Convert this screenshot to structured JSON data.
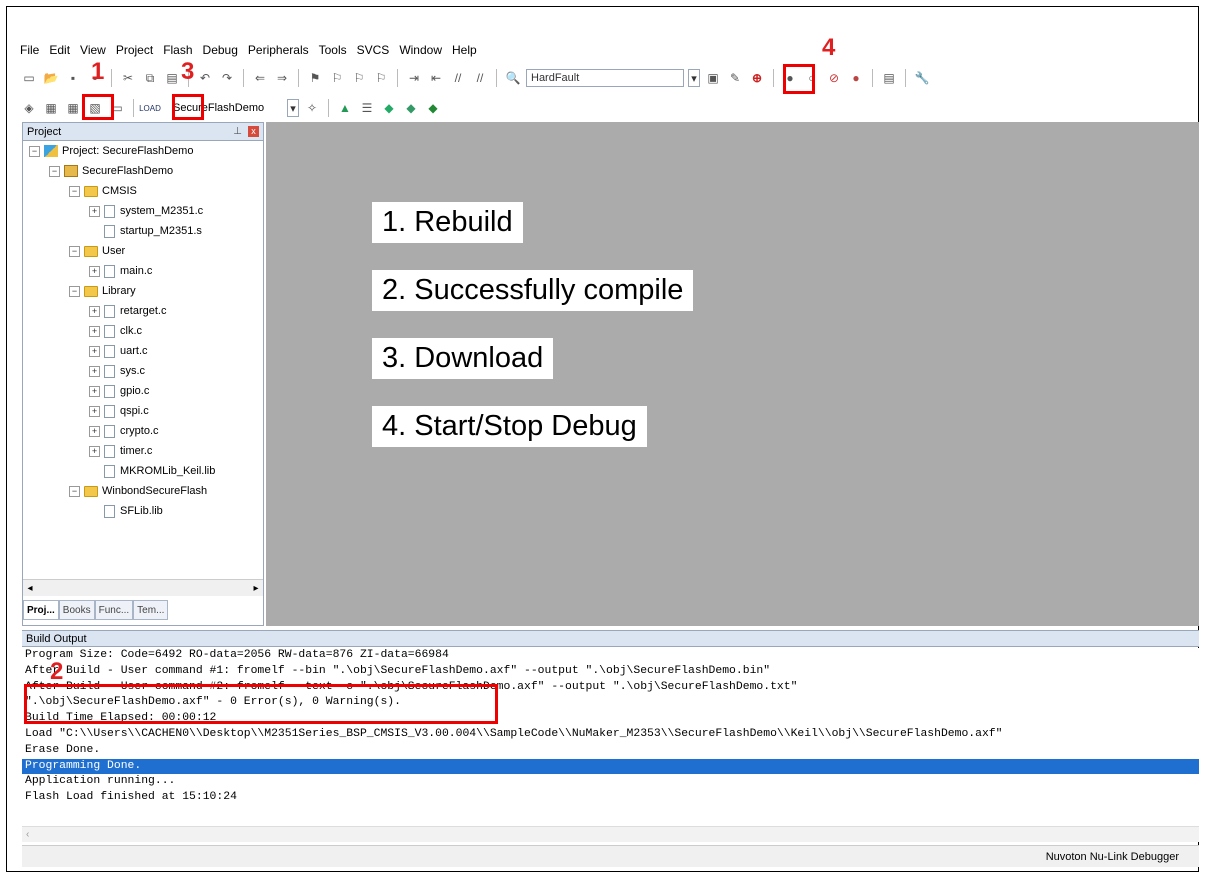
{
  "menu": [
    "File",
    "Edit",
    "View",
    "Project",
    "Flash",
    "Debug",
    "Peripherals",
    "Tools",
    "SVCS",
    "Window",
    "Help"
  ],
  "toolbar": {
    "find_combo": "HardFault",
    "target_combo": "SecureFlashDemo"
  },
  "callouts": {
    "n1": "1",
    "n2": "2",
    "n3": "3",
    "n4": "4"
  },
  "project_panel": {
    "title": "Project",
    "tree": {
      "root": "Project: SecureFlashDemo",
      "target": "SecureFlashDemo",
      "cmsis": "CMSIS",
      "system": "system_M2351.c",
      "startup": "startup_M2351.s",
      "user": "User",
      "main": "main.c",
      "library": "Library",
      "retarget": "retarget.c",
      "clk": "clk.c",
      "uart": "uart.c",
      "sys": "sys.c",
      "gpio": "gpio.c",
      "qspi": "qspi.c",
      "crypto": "crypto.c",
      "timer": "timer.c",
      "mkromlib": "MKROMLib_Keil.lib",
      "winbond": "WinbondSecureFlash",
      "sflib": "SFLib.lib"
    },
    "tabs": [
      "Proj...",
      "Books",
      "Func...",
      "Tem..."
    ]
  },
  "notes": [
    "1. Rebuild",
    "2. Successfully compile",
    "3. Download",
    "4. Start/Stop Debug"
  ],
  "build_output": {
    "title": "Build Output",
    "lines": [
      "Program Size: Code=6492 RO-data=2056 RW-data=876 ZI-data=66984",
      "After Build - User command #1: fromelf --bin \".\\obj\\SecureFlashDemo.axf\" --output \".\\obj\\SecureFlashDemo.bin\"",
      "After Build - User command #2: fromelf --text -c \".\\obj\\SecureFlashDemo.axf\" --output \".\\obj\\SecureFlashDemo.txt\"",
      "\".\\obj\\SecureFlashDemo.axf\" - 0 Error(s), 0 Warning(s).",
      "Build Time Elapsed:  00:00:12",
      "Load \"C:\\\\Users\\\\CACHEN0\\\\Desktop\\\\M2351Series_BSP_CMSIS_V3.00.004\\\\SampleCode\\\\NuMaker_M2353\\\\SecureFlashDemo\\\\Keil\\\\obj\\\\SecureFlashDemo.axf\"",
      "Erase Done.",
      "Programming Done.",
      "Application running...",
      "Flash Load finished at 15:10:24"
    ]
  },
  "status": {
    "debugger": "Nuvoton Nu-Link Debugger"
  }
}
